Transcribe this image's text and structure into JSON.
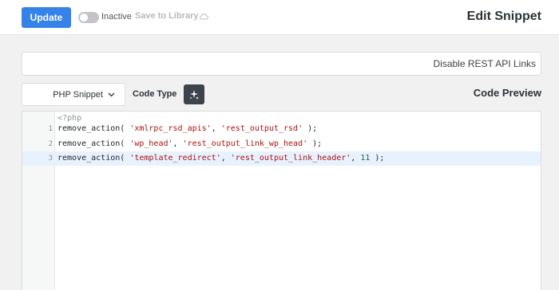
{
  "topbar": {
    "update_label": "Update",
    "status_label": "Inactive",
    "save_library_label": "Save to Library",
    "page_title": "Edit Snippet"
  },
  "snippet": {
    "title_value": "Disable REST API Links",
    "type_selected": "PHP Snippet",
    "code_type_label": "Code Type",
    "preview_label": "Code Preview"
  },
  "editor": {
    "opening_tag": "<?php",
    "lines": [
      {
        "number": "1",
        "fn": "remove_action(",
        "a1": "'xmlrpc_rsd_apis'",
        "a2": "'rest_output_rsd'",
        "a3": "",
        "end": ");"
      },
      {
        "number": "2",
        "fn": "remove_action(",
        "a1": "'wp_head'",
        "a2": "'rest_output_link_wp_head'",
        "a3": "",
        "end": ");"
      },
      {
        "number": "3",
        "fn": "remove_action(",
        "a1": "'template_redirect'",
        "a2": "'rest_output_link_header'",
        "a3": "11",
        "end": ");"
      }
    ],
    "active_line": 3
  },
  "colors": {
    "accent": "#3582e9",
    "string": "#aa1111",
    "number": "#116644"
  },
  "icons": {
    "toggle": "toggle-icon",
    "cloud": "cloud-icon",
    "chevron": "chevron-down-icon",
    "magic": "sparkle-icon"
  }
}
